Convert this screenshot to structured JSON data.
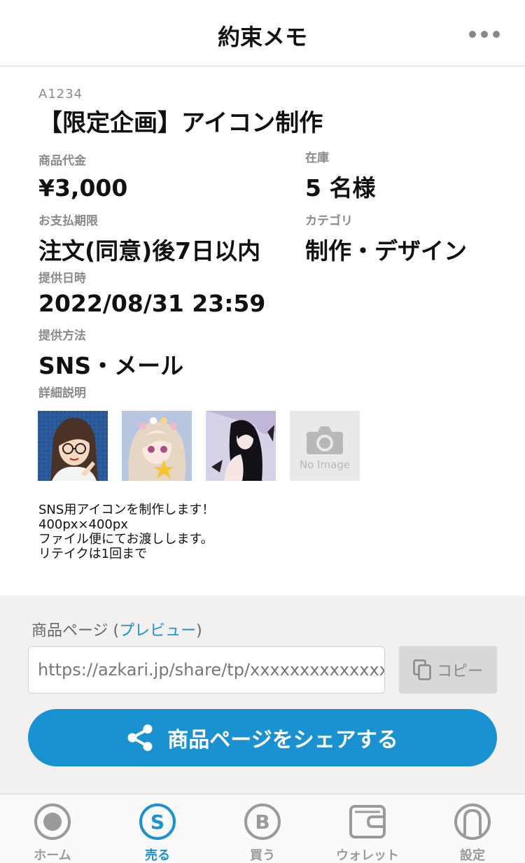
{
  "header": {
    "title": "約束メモ"
  },
  "item": {
    "code": "A1234",
    "title": "【限定企画】アイコン制作",
    "price_label": "商品代金",
    "price": "¥3,000",
    "stock_label": "在庫",
    "stock": "5 名様",
    "due_label": "お支払期限",
    "due": "注文(同意)後7日以内",
    "category_label": "カテゴリ",
    "category": "制作・デザイン",
    "datetime_label": "提供日時",
    "datetime": "2022/08/31 23:59",
    "method_label": "提供方法",
    "method": "SNS・メール",
    "detail_label": "詳細説明",
    "no_image_text": "No Image",
    "description": "SNS用アイコンを制作します！\n400px×400px\nファイル便にてお渡しします。\nリテイクは1回まで"
  },
  "share": {
    "page_label": "商品ページ",
    "paren_open": " (",
    "preview_link": "プレビュー",
    "paren_close": ")",
    "url": "https://azkari.jp/share/tp/xxxxxxxxxxxxxx",
    "copy_label": "コピー",
    "share_button": "商品ページをシェアする"
  },
  "tabs": [
    {
      "label": "ホーム",
      "icon": "home-icon",
      "active": false
    },
    {
      "label": "売る",
      "icon": "sell-icon",
      "active": true
    },
    {
      "label": "買う",
      "icon": "buy-icon",
      "active": false
    },
    {
      "label": "ウォレット",
      "icon": "wallet-icon",
      "active": false
    },
    {
      "label": "設定",
      "icon": "settings-icon",
      "active": false
    }
  ],
  "colors": {
    "accent": "#1a91d0",
    "inactive": "#9a9a9a",
    "share_bg": "#f2f1f0"
  }
}
